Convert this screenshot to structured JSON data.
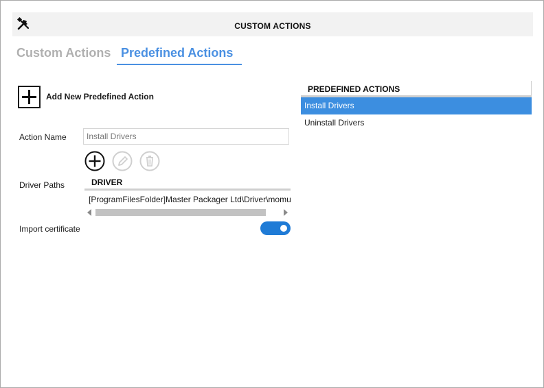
{
  "window": {
    "title": "CUSTOM ACTIONS",
    "icon": "tools-icon"
  },
  "tabs": [
    {
      "label": "Custom Actions",
      "selected": false
    },
    {
      "label": "Predefined Actions",
      "selected": true
    }
  ],
  "add_action": {
    "label": "Add New Predefined Action",
    "icon": "plus-icon"
  },
  "form": {
    "action_name_label": "Action Name",
    "action_name_value": "Install Drivers",
    "driver_paths_label": "Driver Paths",
    "driver_toolbar": [
      {
        "icon": "add-circle-icon",
        "enabled": true
      },
      {
        "icon": "edit-circle-icon",
        "enabled": false
      },
      {
        "icon": "delete-circle-icon",
        "enabled": false
      }
    ],
    "driver_table": {
      "column": "DRIVER",
      "rows": [
        "[ProgramFilesFolder]Master Packager Ltd\\Driver\\momudrv.inf"
      ]
    },
    "import_certificate_label": "Import certificate",
    "import_certificate_on": true
  },
  "predefined_actions": {
    "header": "PREDEFINED ACTIONS",
    "items": [
      {
        "label": "Install Drivers",
        "selected": true
      },
      {
        "label": "Uninstall Drivers",
        "selected": false
      }
    ]
  },
  "colors": {
    "accent": "#4a90e2",
    "selection": "#3c8ee0",
    "toggle_on": "#1f7bd6",
    "tab_inactive": "#b0b0b0"
  }
}
